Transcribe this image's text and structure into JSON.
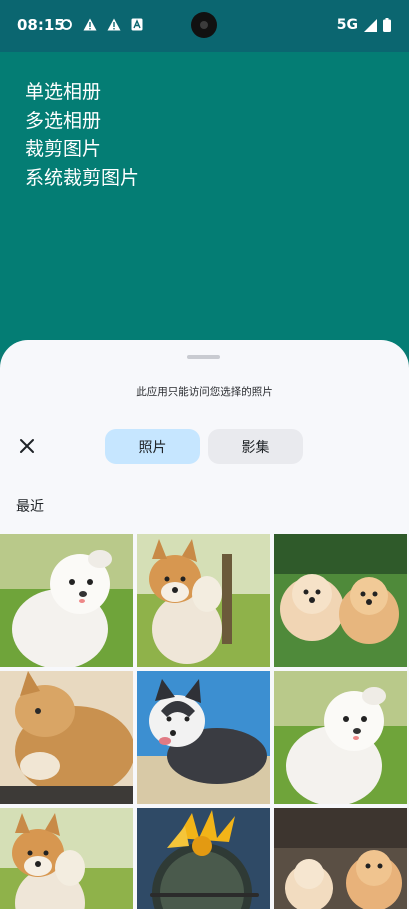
{
  "status": {
    "time": "08:15",
    "network": "5G",
    "icons": [
      "sync-icon",
      "warning-icon",
      "warning-icon",
      "text-icon",
      "signal-icon",
      "battery-icon"
    ]
  },
  "menu": {
    "items": [
      "单选相册",
      "多选相册",
      "裁剪图片",
      "系统裁剪图片"
    ]
  },
  "picker": {
    "notice": "此应用只能访问您选择的照片",
    "tabs": [
      "照片",
      "影集"
    ],
    "section_title": "最近",
    "photos": [
      "white-puppy-photo",
      "shiba-inu-photo",
      "two-pomeranians-photo",
      "cat-photo",
      "husky-photo",
      "white-puppy-photo",
      "shiba-inu-photo",
      "cactus-flower-photo",
      "pomeranians-photo"
    ]
  },
  "colors": {
    "app_background": "#047d74",
    "status_bar": "#0b6670",
    "sheet_background": "#f7f8fb",
    "active_tab": "#c6e6ff",
    "inactive_tab": "#e9eaee"
  }
}
